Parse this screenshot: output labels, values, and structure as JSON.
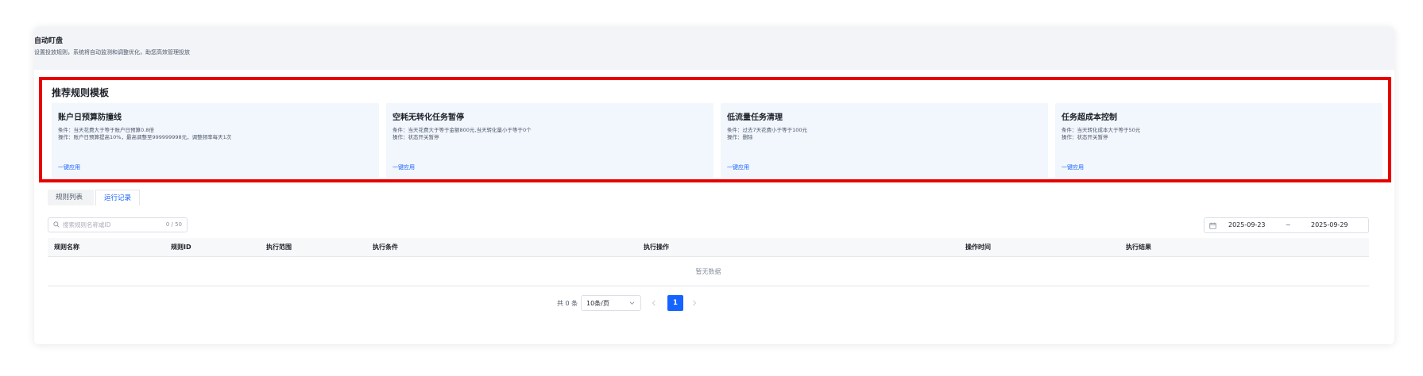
{
  "header": {
    "title": "自动盯盘",
    "description": "设置投放规则，系统将自动监测和调整优化，助您高效管理投放"
  },
  "templates": {
    "heading": "推荐规则模板",
    "cards": [
      {
        "title": "账户日预算防撞线",
        "condition": "条件：当天花费大于等于账户日预算0.8倍",
        "operation": "操作：账户日预算提高10%，最高调整至999999998元，调整频率每天1次",
        "apply_label": "一键应用"
      },
      {
        "title": "空耗无转化任务暂停",
        "condition": "条件：当天花费大于等于金额800元,当天转化量小于等于0个",
        "operation": "操作：状态开关暂停",
        "apply_label": "一键应用"
      },
      {
        "title": "低流量任务清理",
        "condition": "条件：过去7天花费小于等于100元",
        "operation": "操作：删除",
        "apply_label": "一键应用"
      },
      {
        "title": "任务超成本控制",
        "condition": "条件：当天转化成本大于等于50元",
        "operation": "操作：状态开关暂停",
        "apply_label": "一键应用"
      }
    ]
  },
  "tabs": [
    {
      "label": "规则列表",
      "active": false
    },
    {
      "label": "运行记录",
      "active": true
    }
  ],
  "search": {
    "placeholder": "搜索规则名称或ID",
    "count": "0 / 50"
  },
  "date_range": {
    "start": "2025-09-23",
    "separator": "~",
    "end": "2025-09-29"
  },
  "table": {
    "columns": [
      "规则名称",
      "规则ID",
      "执行范围",
      "执行条件",
      "执行操作",
      "操作时间",
      "执行结果"
    ],
    "empty_text": "暂无数据"
  },
  "pagination": {
    "total": "共 0 条",
    "page_size": "10条/页",
    "current_page": "1"
  },
  "colors": {
    "accent": "#1664ff",
    "highlight_border": "#e60000",
    "card_bg": "#f2f6fd"
  }
}
